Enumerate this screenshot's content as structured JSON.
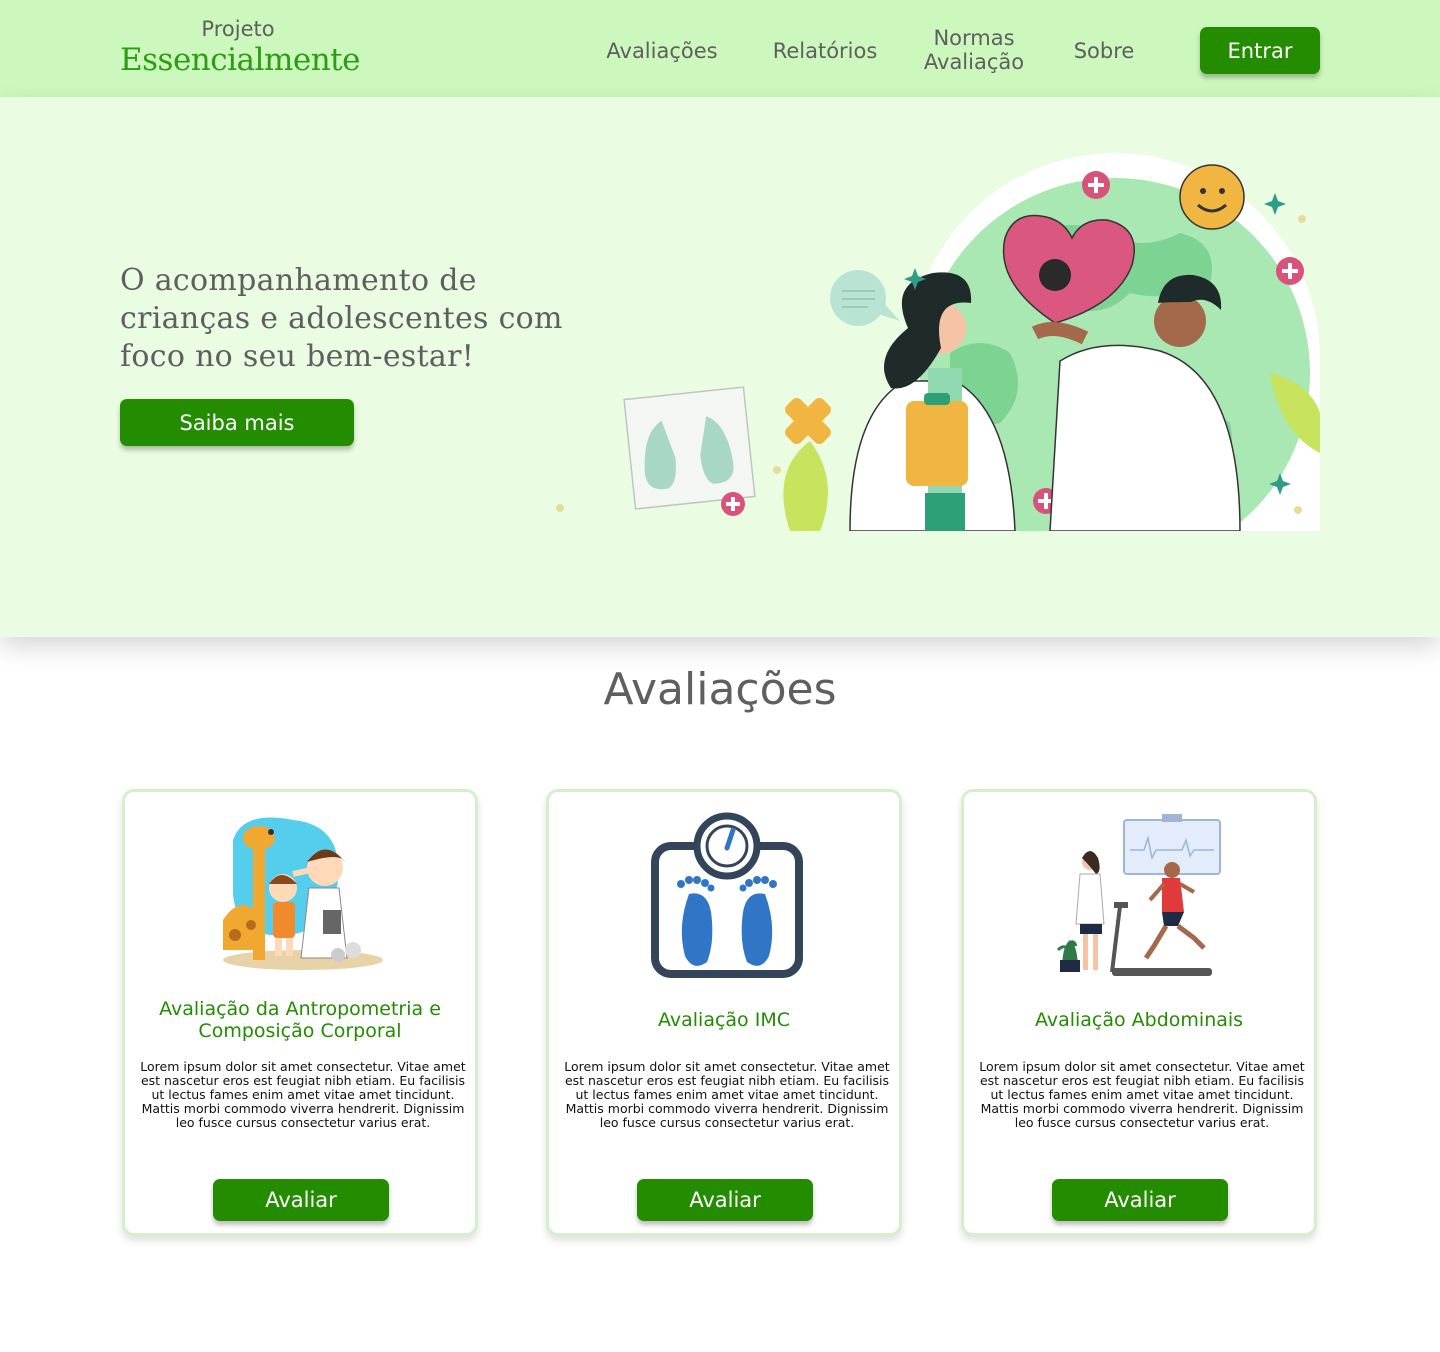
{
  "header": {
    "logo_top": "Projeto",
    "logo_main": "Essencialmente",
    "nav": {
      "avaliacoes": "Avaliações",
      "relatorios": "Relatórios",
      "normas_line1": "Normas",
      "normas_line2": "Avaliação",
      "sobre": "Sobre"
    },
    "login_label": "Entrar"
  },
  "hero": {
    "title": "O acompanhamento de crianças e adolescentes com foco no seu bem-estar!",
    "cta_label": "Saiba mais"
  },
  "section": {
    "title": "Avaliações"
  },
  "cards": [
    {
      "title": "Avaliação da Antropometria e Composição Corporal",
      "text": "Lorem ipsum dolor sit amet consectetur. Vitae amet est nascetur eros est feugiat nibh etiam. Eu facilisis ut lectus fames enim amet vitae amet tincidunt. Mattis morbi commodo viverra hendrerit. Dignissim leo fusce cursus consectetur varius erat.",
      "button": "Avaliar",
      "image": "child-height-measurement-illustration"
    },
    {
      "title": "Avaliação IMC",
      "text": "Lorem ipsum dolor sit amet consectetur. Vitae amet est nascetur eros est feugiat nibh etiam. Eu facilisis ut lectus fames enim amet vitae amet tincidunt. Mattis morbi commodo viverra hendrerit. Dignissim leo fusce cursus consectetur varius erat.",
      "button": "Avaliar",
      "image": "weight-scale-icon"
    },
    {
      "title": "Avaliação Abdominais",
      "text": "Lorem ipsum dolor sit amet consectetur. Vitae amet est nascetur eros est feugiat nibh etiam. Eu facilisis ut lectus fames enim amet vitae amet tincidunt. Mattis morbi commodo viverra hendrerit. Dignissim leo fusce cursus consectetur varius erat.",
      "button": "Avaliar",
      "image": "treadmill-test-illustration"
    }
  ],
  "colors": {
    "header_bg": "#ccf8bd",
    "hero_bg": "#eafde2",
    "primary_green": "#238c00",
    "text_gray": "#5f5f5f",
    "card_border": "#d3efcc"
  }
}
